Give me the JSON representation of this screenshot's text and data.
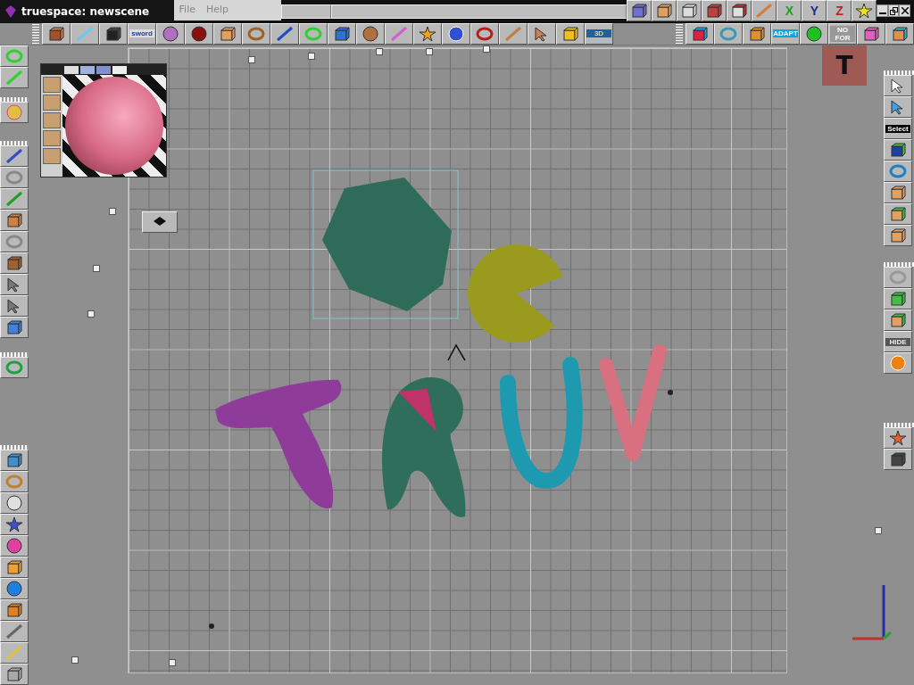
{
  "title_bar": {
    "title": "truespace: newscene"
  },
  "menu": [
    "File",
    "Help"
  ],
  "axis_buttons": [
    {
      "label": "X",
      "color": "#1fa01f"
    },
    {
      "label": "Y",
      "color": "#1a2a9a"
    },
    {
      "label": "Z",
      "color": "#c02020"
    }
  ],
  "main_toolbar": {
    "sword_label": "sword",
    "plug_label": "3D"
  },
  "right_toolbar": {
    "adapt_label": "ADAPT",
    "nofor_label": "NO FOR"
  },
  "side_panel": {
    "select_label": "Select",
    "hide_label": "HIDE"
  },
  "viewport": {
    "badge": "T"
  }
}
